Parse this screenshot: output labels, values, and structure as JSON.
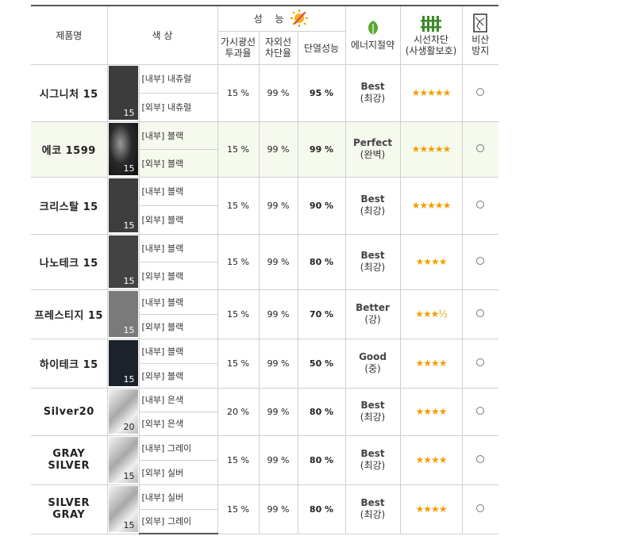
{
  "header": {
    "product": "제품명",
    "color": "색 상",
    "performance": "성 능",
    "visible_1": "가시광선",
    "visible_2": "투과율",
    "uv_1": "자외선",
    "uv_2": "차단율",
    "insulation": "단열성능",
    "energy": "에너지절약",
    "privacy_1": "시선차단",
    "privacy_2": "(사생활보호)",
    "scatter_1": "비산",
    "scatter_2": "방지"
  },
  "rows": [
    {
      "name": "시그니처 15",
      "swatch_label": "15",
      "inner": "[내부] 내츄럴",
      "outer": "[외부] 내츄럴",
      "visible": "15 %",
      "uv": "99 %",
      "insulation": "95 %",
      "grade": "Best",
      "grade_sub": "(최강)",
      "stars": "★★★★★",
      "scatter": "○",
      "swatch_color": "#3c3c3c"
    },
    {
      "name": "에코 1599",
      "swatch_label": "15",
      "inner": "[내부] 블랙",
      "outer": "[외부] 블랙",
      "visible": "15 %",
      "uv": "99 %",
      "insulation": "99 %",
      "grade": "Perfect",
      "grade_sub": "(완벽)",
      "stars": "★★★★★",
      "scatter": "○",
      "swatch_color": "#202020"
    },
    {
      "name": "크리스탈 15",
      "swatch_label": "15",
      "inner": "[내부] 블랙",
      "outer": "[외부] 블랙",
      "visible": "15 %",
      "uv": "99 %",
      "insulation": "90 %",
      "grade": "Best",
      "grade_sub": "(최강)",
      "stars": "★★★★★",
      "scatter": "○",
      "swatch_color": "#3d3d3d"
    },
    {
      "name": "나노테크 15",
      "swatch_label": "15",
      "inner": "[내부] 블랙",
      "outer": "[외부] 블랙",
      "visible": "15 %",
      "uv": "99 %",
      "insulation": "80 %",
      "grade": "Best",
      "grade_sub": "(최강)",
      "stars": "★★★★",
      "scatter": "○",
      "swatch_color": "#434343"
    },
    {
      "name": "프레스티지 15",
      "swatch_label": "15",
      "inner": "[내부] 블랙",
      "outer": "[외부] 블랙",
      "visible": "15 %",
      "uv": "99 %",
      "insulation": "70 %",
      "grade": "Better",
      "grade_sub": "(강)",
      "stars": "★★★½",
      "scatter": "○",
      "swatch_color": "#7a7a7a"
    },
    {
      "name": "하이테크 15",
      "swatch_label": "15",
      "inner": "[내부] 블랙",
      "outer": "[외부] 블랙",
      "visible": "15 %",
      "uv": "99 %",
      "insulation": "50 %",
      "grade": "Good",
      "grade_sub": "(중)",
      "stars": "★★★★",
      "scatter": "○",
      "swatch_color": "#1c222b"
    },
    {
      "name": "Silver20",
      "swatch_label": "20",
      "inner": "[내부] 은색",
      "outer": "[외부] 은색",
      "visible": "20 %",
      "uv": "99 %",
      "insulation": "80 %",
      "grade": "Best",
      "grade_sub": "(최강)",
      "stars": "★★★★",
      "scatter": "○",
      "swatch_color": "#c8c8c8"
    },
    {
      "name": "GRAY SILVER",
      "swatch_label": "15",
      "inner": "[내부] 그레이",
      "outer": "[외부] 실버",
      "visible": "15 %",
      "uv": "99 %",
      "insulation": "80 %",
      "grade": "Best",
      "grade_sub": "(최강)",
      "stars": "★★★★",
      "scatter": "○",
      "swatch_color": "#d5d5d5"
    },
    {
      "name": "SILVER GRAY",
      "swatch_label": "15",
      "inner": "[내부] 실버",
      "outer": "[외부] 그레이",
      "visible": "15 %",
      "uv": "99 %",
      "insulation": "80 %",
      "grade": "Best",
      "grade_sub": "(최강)",
      "stars": "★★★★",
      "scatter": "○",
      "swatch_color": "#d0d0d0"
    }
  ],
  "colors": {
    "border_dark": "#555555",
    "star": "#f0a000",
    "tint": "#f5f9ee",
    "leaf": "#5aa830",
    "fence": "#3d8a2a"
  }
}
